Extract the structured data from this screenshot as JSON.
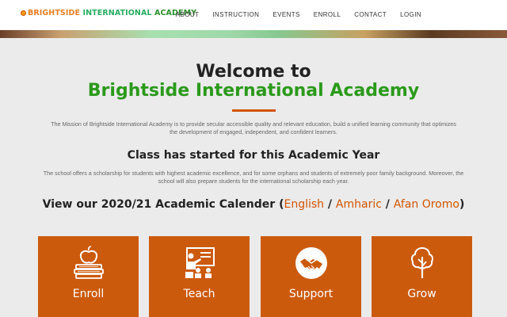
{
  "brand": {
    "logo_word1": "BRIGHTSIDE",
    "logo_word2": "INTERNATIONAL",
    "logo_word3": "ACADEMY"
  },
  "nav": {
    "items": [
      {
        "label": "ABOUT"
      },
      {
        "label": "INSTRUCTION"
      },
      {
        "label": "EVENTS"
      },
      {
        "label": "ENROLL"
      },
      {
        "label": "CONTACT"
      },
      {
        "label": "LOGIN"
      }
    ]
  },
  "hero": {
    "welcome": "Welcome to",
    "academy": "Brightside International Academy"
  },
  "mission": "The Mission of Brightside International Academy is to provide secular accessible quality and relevant education, build a unified learning community that optimizes the development of engaged, independent, and confident learners.",
  "class_started": "Class has started for this Academic Year",
  "scholarship": "The school offers a scholarship for students with highest academic excellence, and for some orphans and students of extremely poor family background. Moreover, the school will also prepare students for the international scholarship each year.",
  "calendar": {
    "prefix": "View our 2020/21 Academic Calender (",
    "links": [
      "English",
      "Amharic",
      "Afan Oromo"
    ],
    "separator": " / ",
    "suffix": ")"
  },
  "cards": [
    {
      "label": "Enroll",
      "icon": "books-apple-icon"
    },
    {
      "label": "Teach",
      "icon": "teacher-board-icon"
    },
    {
      "label": "Support",
      "icon": "handshake-icon"
    },
    {
      "label": "Grow",
      "icon": "tree-icon"
    }
  ],
  "colors": {
    "accent": "#cc5a0d",
    "academy_green": "#2a9a1a",
    "background": "#ebebeb"
  }
}
